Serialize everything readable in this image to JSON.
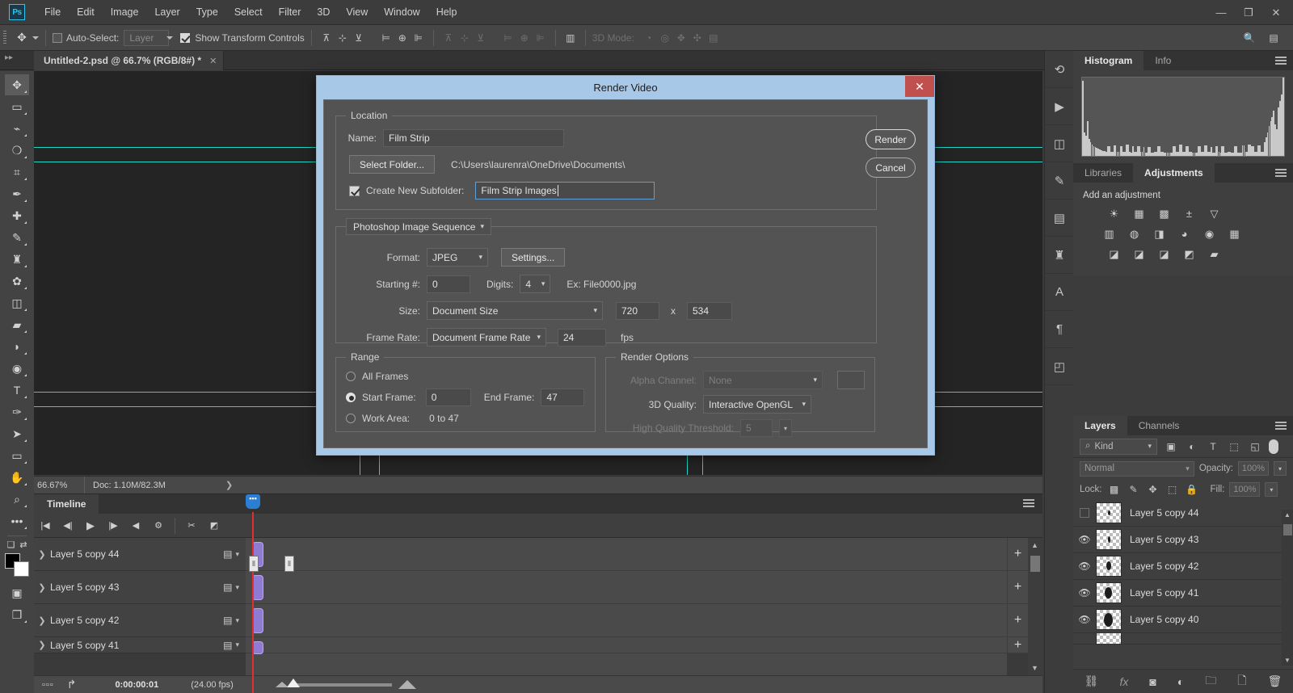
{
  "app": {
    "logo": "Ps",
    "menus": [
      "File",
      "Edit",
      "Image",
      "Layer",
      "Type",
      "Select",
      "Filter",
      "3D",
      "View",
      "Window",
      "Help"
    ],
    "window_controls": {
      "minimize": "—",
      "maximize": "❐",
      "close": "✕"
    }
  },
  "options_bar": {
    "auto_select_label": "Auto-Select:",
    "auto_select_checked": false,
    "layer_dropdown": "Layer",
    "show_transform_label": "Show Transform Controls",
    "show_transform_checked": true,
    "mode_3d_label": "3D Mode:"
  },
  "document_tab": {
    "title": "Untitled-2.psd @ 66.7% (RGB/8#) *",
    "close": "✕"
  },
  "status_bar": {
    "zoom": "66.67%",
    "doc_info": "Doc: 1.10M/82.3M",
    "arrow": "❯"
  },
  "tools": [
    {
      "name": "move-tool",
      "glyph": "✥",
      "selected": true
    },
    {
      "name": "marquee-tool",
      "glyph": "▭",
      "selected": false
    },
    {
      "name": "lasso-tool",
      "glyph": "⌁",
      "selected": false
    },
    {
      "name": "quick-selection-tool",
      "glyph": "❍",
      "selected": false
    },
    {
      "name": "crop-tool",
      "glyph": "⌗",
      "selected": false
    },
    {
      "name": "eyedropper-tool",
      "glyph": "✒",
      "selected": false
    },
    {
      "name": "spot-healing-tool",
      "glyph": "✚",
      "selected": false
    },
    {
      "name": "brush-tool",
      "glyph": "✎",
      "selected": false
    },
    {
      "name": "clone-stamp-tool",
      "glyph": "♜",
      "selected": false
    },
    {
      "name": "history-brush-tool",
      "glyph": "✿",
      "selected": false
    },
    {
      "name": "eraser-tool",
      "glyph": "◫",
      "selected": false
    },
    {
      "name": "gradient-tool",
      "glyph": "▰",
      "selected": false
    },
    {
      "name": "blur-tool",
      "glyph": "💧",
      "selected": false
    },
    {
      "name": "dodge-tool",
      "glyph": "◉",
      "selected": false
    },
    {
      "name": "type-tool",
      "glyph": "T",
      "selected": false
    },
    {
      "name": "pen-tool",
      "glyph": "✑",
      "selected": false
    },
    {
      "name": "path-selection-tool",
      "glyph": "➤",
      "selected": false
    },
    {
      "name": "rectangle-tool",
      "glyph": "▭",
      "selected": false
    },
    {
      "name": "hand-tool",
      "glyph": "✋",
      "selected": false
    },
    {
      "name": "zoom-tool",
      "glyph": "🔍",
      "selected": false
    },
    {
      "name": "edit-toolbar-tool",
      "glyph": "•••",
      "selected": false
    }
  ],
  "dialog": {
    "title": "Render Video",
    "close": "✕",
    "buttons": {
      "render": "Render",
      "cancel": "Cancel"
    },
    "location": {
      "legend": "Location",
      "name_label": "Name:",
      "name_value": "Film Strip",
      "select_folder_button": "Select Folder...",
      "path": "C:\\Users\\laurenra\\OneDrive\\Documents\\",
      "create_subfolder_label": "Create New Subfolder:",
      "create_subfolder_checked": true,
      "subfolder_value": "Film Strip Images"
    },
    "output": {
      "preset": "Photoshop Image Sequence",
      "format_label": "Format:",
      "format_value": "JPEG",
      "settings_button": "Settings...",
      "starting_label": "Starting #:",
      "starting_value": "0",
      "digits_label": "Digits:",
      "digits_value": "4",
      "example": "Ex: File0000.jpg",
      "size_label": "Size:",
      "size_value": "Document Size",
      "width": "720",
      "x_sep": "x",
      "height": "534",
      "frame_rate_label": "Frame Rate:",
      "frame_rate_value": "Document Frame Rate",
      "fps_value": "24",
      "fps_unit": "fps"
    },
    "range": {
      "legend": "Range",
      "all_frames_label": "All Frames",
      "all_frames_selected": false,
      "start_frame_label": "Start Frame:",
      "start_frame_selected": true,
      "start_frame_value": "0",
      "end_frame_label": "End Frame:",
      "end_frame_value": "47",
      "work_area_label": "Work Area:",
      "work_area_selected": false,
      "work_area_value": "0 to 47"
    },
    "render_options": {
      "legend": "Render Options",
      "alpha_label": "Alpha Channel:",
      "alpha_value": "None",
      "quality_label": "3D Quality:",
      "quality_value": "Interactive OpenGL",
      "threshold_label": "High Quality Threshold:",
      "threshold_value": "5"
    }
  },
  "histogram_panel": {
    "tabs": [
      "Histogram",
      "Info"
    ],
    "active_tab": "Histogram",
    "bars": [
      96,
      30,
      26,
      44,
      22,
      18,
      14,
      12,
      11,
      10,
      9,
      8,
      7,
      6,
      6,
      5,
      12,
      12,
      5,
      5,
      13,
      13,
      5,
      5,
      12,
      12,
      5,
      5,
      14,
      14,
      5,
      4,
      12,
      5,
      5,
      12,
      12,
      5,
      5,
      11,
      4,
      4,
      11,
      11,
      4,
      4,
      5,
      5,
      12,
      12,
      5,
      5,
      4,
      4,
      4,
      4,
      4,
      4,
      12,
      12,
      5,
      5,
      14,
      14,
      5,
      5,
      12,
      12,
      5,
      5,
      4,
      4,
      4,
      4,
      12,
      12,
      5,
      5,
      13,
      13,
      5,
      5,
      11,
      4,
      4,
      12,
      12,
      5,
      4,
      12,
      12,
      4,
      4,
      5,
      5,
      4,
      4,
      12,
      12,
      4,
      4,
      4,
      13,
      13,
      5,
      5,
      14,
      14,
      12,
      12,
      5,
      5,
      13,
      13,
      5,
      5,
      18,
      24,
      30,
      38,
      44,
      50,
      58,
      40,
      34,
      62,
      70,
      78,
      100
    ]
  },
  "adjustments_panel": {
    "tabs": [
      "Libraries",
      "Adjustments"
    ],
    "active_tab": "Adjustments",
    "title": "Add an adjustment",
    "icons": [
      [
        "brightness-contrast-icon",
        "levels-icon",
        "curves-icon",
        "exposure-icon",
        "vibrance-icon"
      ],
      [
        "color-balance-icon",
        "black-white-icon",
        "photo-filter-icon",
        "channel-mixer-icon",
        "color-lookup-icon",
        "posterize-icon"
      ],
      [
        "invert-icon",
        "threshold-icon",
        "gradient-map-icon",
        "selective-color-icon",
        "hue-saturation-icon"
      ]
    ]
  },
  "layers_panel": {
    "tabs": [
      "Layers",
      "Channels"
    ],
    "active_tab": "Layers",
    "filter_label": "Kind",
    "blend_mode": "Normal",
    "opacity_label": "Opacity:",
    "opacity_value": "100%",
    "lock_label": "Lock:",
    "fill_label": "Fill:",
    "fill_value": "100%",
    "layers": [
      {
        "name": "Layer 5 copy 44",
        "visible": false
      },
      {
        "name": "Layer 5 copy 43",
        "visible": true
      },
      {
        "name": "Layer 5 copy 42",
        "visible": true
      },
      {
        "name": "Layer 5 copy 41",
        "visible": true
      },
      {
        "name": "Layer 5 copy 40",
        "visible": true
      }
    ],
    "bottom_buttons": [
      "link-layers-icon",
      "layer-style-icon",
      "layer-mask-icon",
      "adjustment-layer-icon",
      "new-group-icon",
      "new-layer-icon",
      "delete-layer-icon"
    ]
  },
  "timeline_panel": {
    "tab": "Timeline",
    "transport": [
      "go-to-first-frame-icon",
      "previous-frame-icon",
      "play-icon",
      "next-frame-icon",
      "audio-icon",
      "settings-gear-icon"
    ],
    "tools": [
      "split-clip-icon",
      "transition-icon"
    ],
    "tracks": [
      {
        "name": "Layer 5 copy 44"
      },
      {
        "name": "Layer 5 copy 43"
      },
      {
        "name": "Layer 5 copy 42"
      },
      {
        "name": "Layer 5 copy 41"
      }
    ],
    "current_time": "0:00:00:01",
    "frame_rate": "(24.00 fps)",
    "add_button": "+"
  },
  "colors": {
    "dialog_titlebar": "#a8c8e8",
    "close_red": "#c0504d",
    "guide_cyan": "#25f4e6",
    "playhead_red": "#e03030",
    "clip_purple": "#8f7ad4",
    "playhead_blue": "#2a7fd4",
    "accent_blue": "#31c5f0"
  }
}
